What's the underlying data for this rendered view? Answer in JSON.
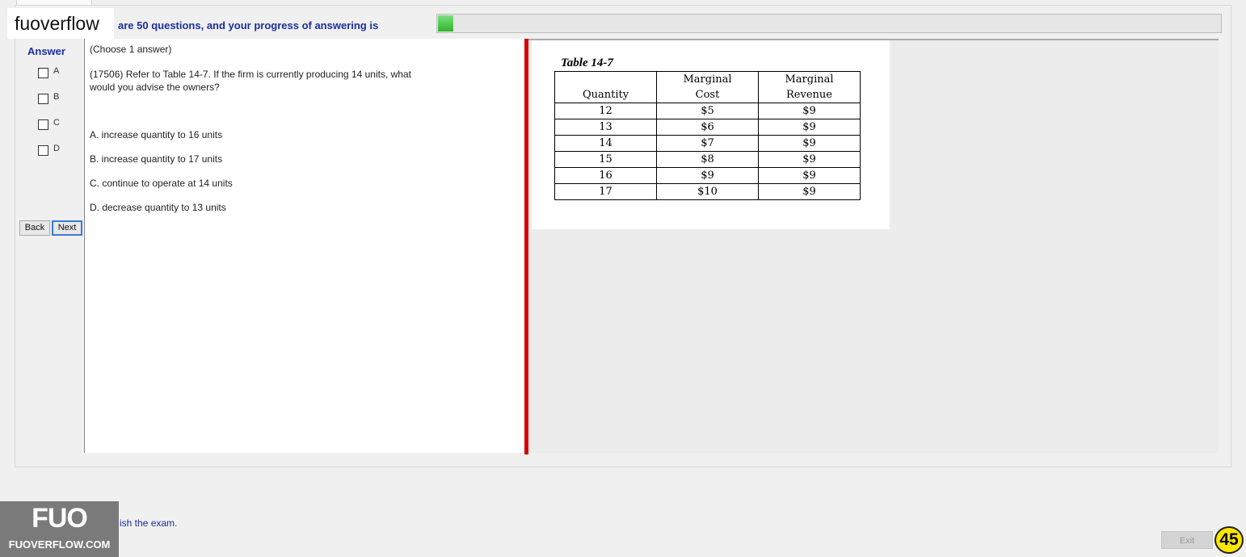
{
  "header": {
    "brand": "fuoverflow",
    "progress_text": "are 50 questions, and your progress of answering is",
    "progress_fraction": 0.02
  },
  "answer_panel": {
    "title": "Answer",
    "options": [
      "A",
      "B",
      "C",
      "D"
    ],
    "back_label": "Back",
    "next_label": "Next"
  },
  "question": {
    "instruction": "(Choose 1 answer)",
    "text": "(17506)  Refer to Table 14-7. If the firm is currently producing 14 units, what would you advise the owners?",
    "answers": [
      "A.  increase quantity to 16 units",
      "B.  increase quantity to 17 units",
      "C.  continue to operate at 14 units",
      "D.  decrease quantity to 13 units"
    ]
  },
  "table": {
    "caption": "Table 14-7",
    "headers": [
      [
        "",
        "Quantity"
      ],
      [
        "Marginal",
        "Cost"
      ],
      [
        "Marginal",
        "Revenue"
      ]
    ],
    "rows": [
      [
        "12",
        "$5",
        "$9"
      ],
      [
        "13",
        "$6",
        "$9"
      ],
      [
        "14",
        "$7",
        "$9"
      ],
      [
        "15",
        "$8",
        "$9"
      ],
      [
        "16",
        "$9",
        "$9"
      ],
      [
        "17",
        "$10",
        "$9"
      ]
    ]
  },
  "footer": {
    "finish_text": "ish the exam.",
    "logo_big": "FUO",
    "logo_small": "FUOVERFLOW.COM",
    "exit_label": "Exit",
    "page_badge": "45"
  }
}
